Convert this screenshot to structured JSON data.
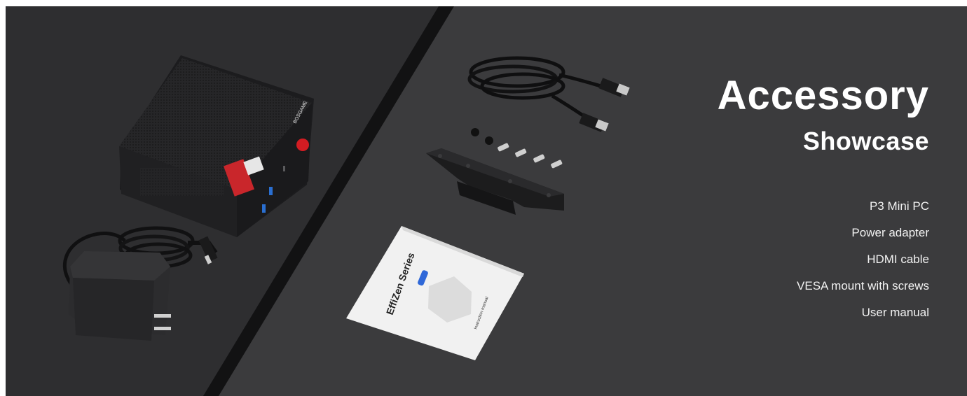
{
  "heading": {
    "title": "Accessory",
    "subtitle": "Showcase"
  },
  "items": [
    "P3 Mini PC",
    "Power adapter",
    "HDMI cable",
    "VESA mount with screws",
    "User manual"
  ],
  "product": {
    "brand_label": "BOSGAME",
    "manual_title": "EffiZen Series",
    "manual_caption": "Instruction manual"
  },
  "colors": {
    "background_dark": "#2f2f31",
    "background_light": "#3c3c3e",
    "text": "#ffffff"
  }
}
